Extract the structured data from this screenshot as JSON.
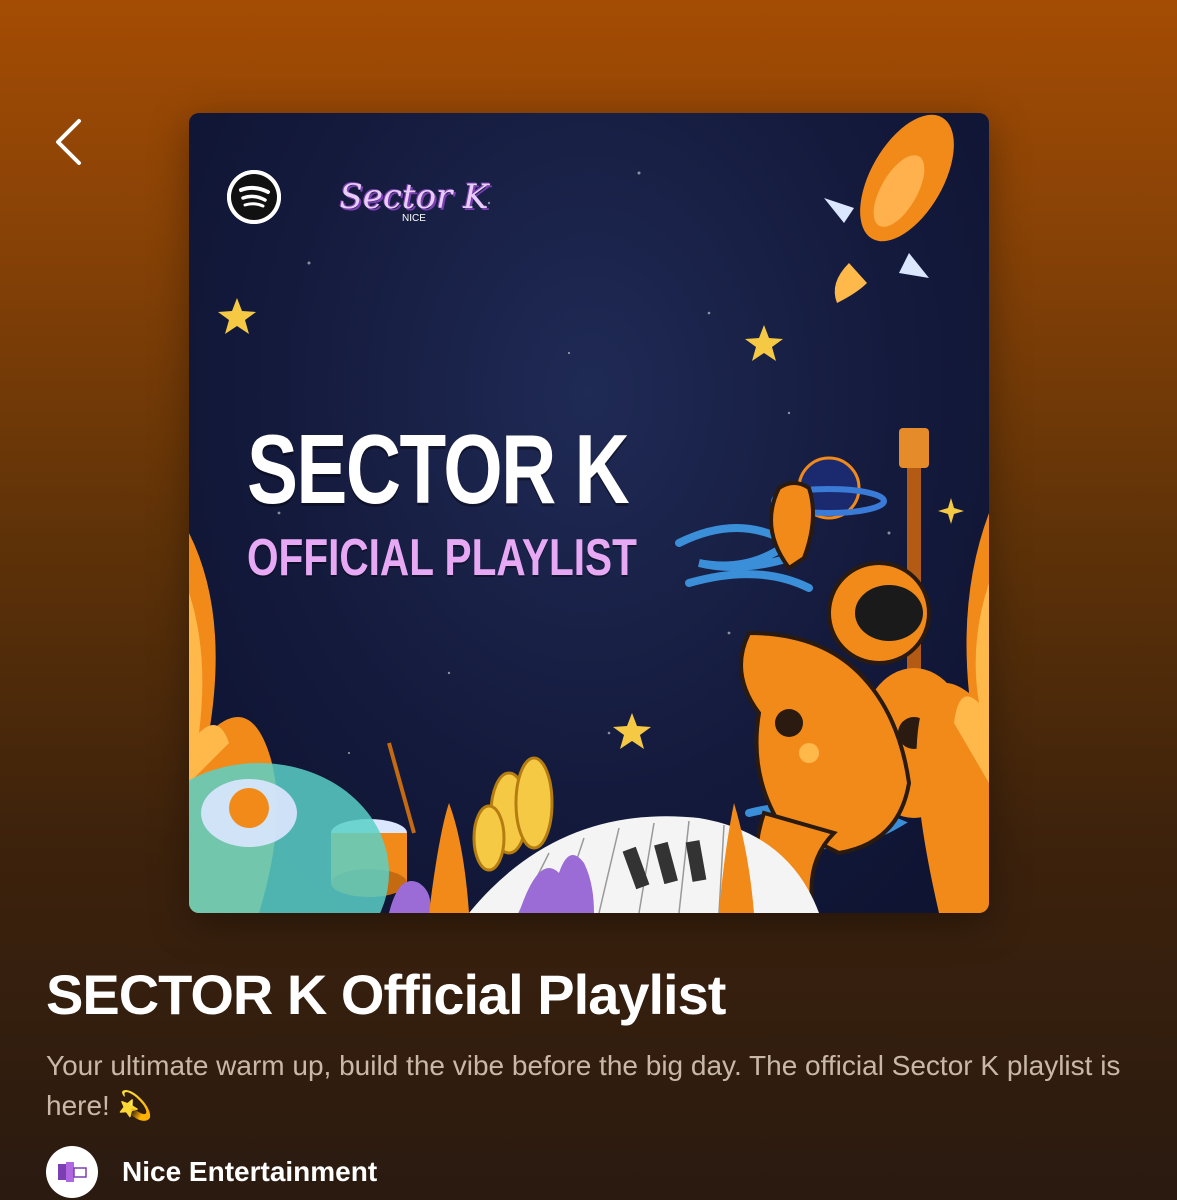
{
  "header": {
    "back_label": "Back"
  },
  "cover": {
    "brand_logo_text": "Sector K",
    "brand_logo_sub": "NICE",
    "title": "SECTOR K",
    "subtitle": "OFFICIAL PLAYLIST"
  },
  "playlist": {
    "title": "SECTOR K Official Playlist",
    "description": "Your ultimate warm up, build the vibe before the big day. The official Sector K playlist is here! 💫",
    "owner": "Nice Entertainment"
  },
  "colors": {
    "gradient_top": "#a44c04",
    "gradient_bottom": "#2a1a10",
    "cover_bg": "#141a3c",
    "accent_orange": "#f28a1a",
    "accent_pink": "#e7a8f4"
  },
  "icons": {
    "back": "chevron-left-icon",
    "spotify": "spotify-icon",
    "avatar": "nice-entertainment-logo"
  }
}
